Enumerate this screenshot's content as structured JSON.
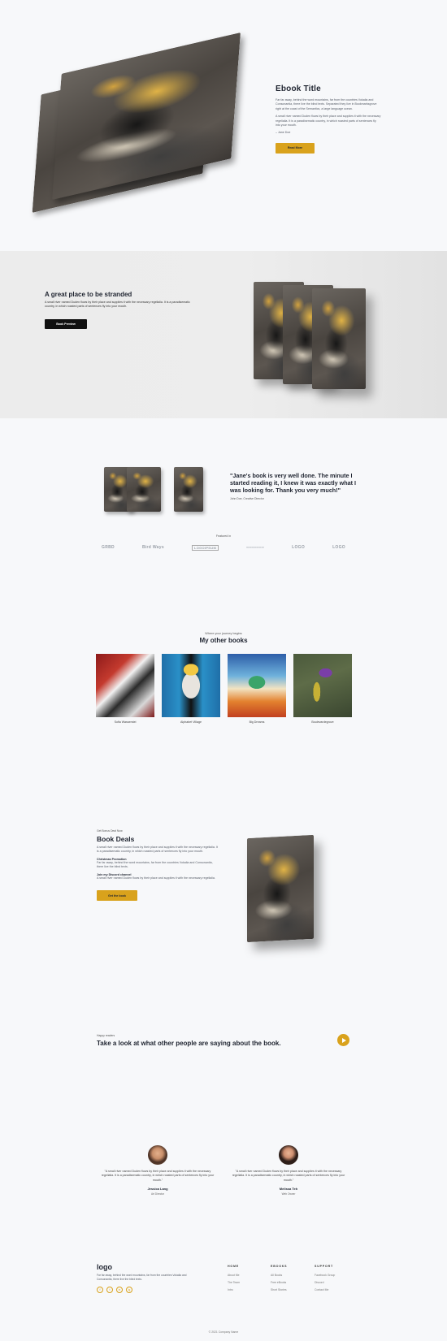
{
  "hero": {
    "title": "Ebook Title",
    "paragraph1": "Far far away, behind the word mountains, far from the countries Vokalia and Consonantia, there live the blind texts. Separated they live in Bookmarksgrove right at the coast of the Semantics, a large language ocean.",
    "paragraph2": "A small river named Duden flows by their place and supplies it with the necessary regelialia. It is a paradisematic country, in which roasted parts of sentences fly into your mouth.",
    "author": "– Jane Doe",
    "button": "Read More"
  },
  "stranded": {
    "title": "A great place to be stranded",
    "text": "A small river named Duden flows by their place and supplies it with the necessary regelialia. It is a paradisematic country, in which roasted parts of sentences fly into your mouth.",
    "button": "Book Preview"
  },
  "quote": {
    "text": "\"Jane's book is very well done. The minute I started reading it, I knew it was exactly what I was looking for. Thank you very much!\"",
    "author": "John Doe, Creative Director"
  },
  "featured": {
    "label": "Featured in",
    "logos": [
      "GRBD",
      "Bird Ways",
      "LOGOIPSUM",
      "═══════",
      "LOGO",
      "LOGO"
    ]
  },
  "other_books": {
    "eyebrow": "Where your journey begins",
    "title": "My other books",
    "books": [
      {
        "title": "Sofia Wasserstei"
      },
      {
        "title": "Alphabet Village"
      },
      {
        "title": "Big Dreams"
      },
      {
        "title": "Boulevardegrove"
      }
    ]
  },
  "deals": {
    "eyebrow": "Get Bonus Deal Now",
    "title": "Book Deals",
    "text": "A small river named Duden flows by their place and supplies it with the necessary regelialia. It is a paradisematic country, in which roasted parts of sentences fly into your mouth.",
    "promo_title": "Christmas Promotion",
    "promo_text": "Far far away, behind the word mountains, far from the countries Vokalia and Consonantia, there live the blind texts.",
    "discord_title": "Join my Discord channel",
    "discord_text": "A small river named Duden flows by their place and supplies it with the necessary regelialia.",
    "button": "Get the book"
  },
  "testimonials_cta": {
    "eyebrow": "Happy readers",
    "title": "Take a look at what other people are saying about the book."
  },
  "testimonials": [
    {
      "quote": "\"A small river named Duden flows by their place and supplies it with the necessary regelialia. It is a paradisematic country, in which roasted parts of sentences fly into your mouth.\"",
      "name": "Jessica Lang",
      "role": "Art Director"
    },
    {
      "quote": "\"A small river named Duden flows by their place and supplies it with the necessary regelialia. It is a paradisematic country, in which roasted parts of sentences fly into your mouth.\"",
      "name": "Melissa Teh",
      "role": "Web Owner"
    }
  ],
  "footer": {
    "logo": "logo",
    "about": "Far far away, behind the word mountains, far from the countries Vokalia and Consonantia, there live the blind texts.",
    "social": [
      "f",
      "t",
      "in",
      "ig"
    ],
    "columns": [
      {
        "head": "HOME",
        "links": [
          "About Me",
          "The Team",
          "Intro"
        ]
      },
      {
        "head": "EBOOKS",
        "links": [
          "All Books",
          "Free eBooks",
          "Short Stories"
        ]
      },
      {
        "head": "SUPPORT",
        "links": [
          "Facebook Group",
          "Discord",
          "Contact Me"
        ]
      }
    ],
    "copyright": "© 2021 Company Name"
  },
  "colors": {
    "accent": "#d9a21c",
    "dark": "#111111",
    "bg": "#f7f8fa"
  }
}
